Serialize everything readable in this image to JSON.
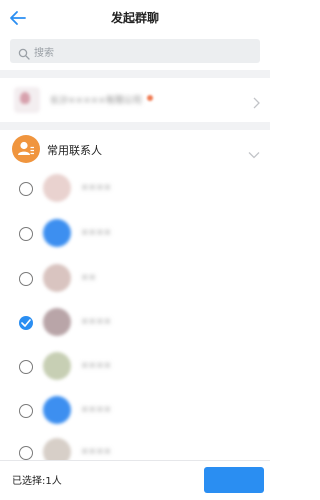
{
  "header": {
    "title": "发起群聊",
    "back_icon": "back-arrow-icon"
  },
  "search": {
    "placeholder": "搜索",
    "icon": "search-icon"
  },
  "company": {
    "name": "长沙×××××有限公司",
    "badge_color": "#f07a52"
  },
  "group": {
    "label": "常用联系人",
    "icon_color": "#f0953e"
  },
  "contacts": [
    {
      "name": "××××",
      "checked": false,
      "avatar_color": "#e9d2cf"
    },
    {
      "name": "××××",
      "checked": false,
      "avatar_color": "#3d8ff0"
    },
    {
      "name": "××",
      "checked": false,
      "avatar_color": "#d9c4c0"
    },
    {
      "name": "××××",
      "checked": true,
      "avatar_color": "#b9a5a8"
    },
    {
      "name": "××××",
      "checked": false,
      "avatar_color": "#c7cfb4"
    },
    {
      "name": "××××",
      "checked": false,
      "avatar_color": "#3d8ff0"
    },
    {
      "name": "××××",
      "checked": false,
      "avatar_color": "#d7cfc8"
    }
  ],
  "footer": {
    "selected_text": "已选择:1人",
    "confirm_color": "#2a8ef2"
  },
  "colors": {
    "accent": "#2a8ef2",
    "separator": "#f1f2f4"
  }
}
